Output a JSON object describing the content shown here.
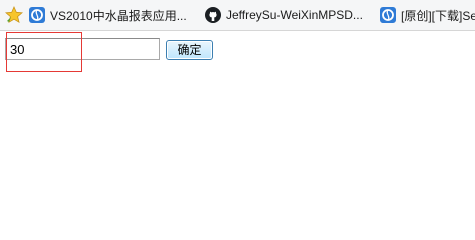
{
  "bookmarks": {
    "items": [
      {
        "label": "VS2010中水晶报表应用...",
        "icon": "browser-logo-icon"
      },
      {
        "label": "JeffreySu-WeiXinMPSD...",
        "icon": "github-icon"
      },
      {
        "label": "[原创][下载]Se",
        "icon": "browser-logo-icon"
      }
    ]
  },
  "form": {
    "input_value": "30",
    "confirm_label": "确定"
  },
  "colors": {
    "highlight": "#e53935",
    "button_border": "#3c7fb1"
  }
}
